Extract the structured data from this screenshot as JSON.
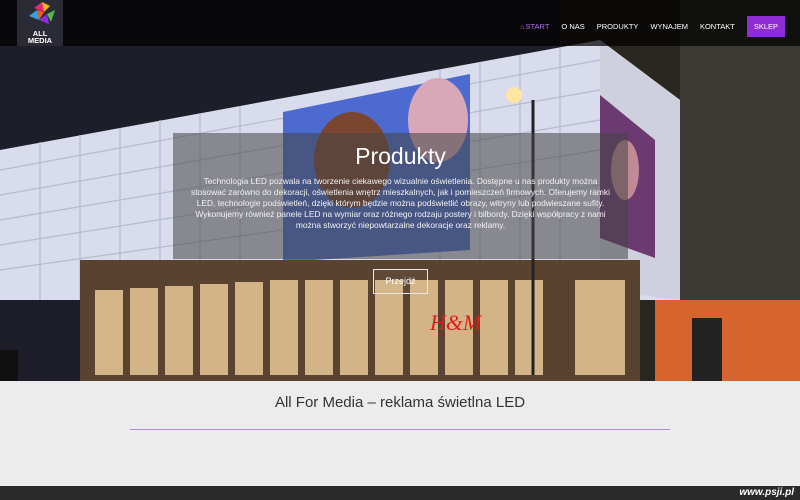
{
  "brand": {
    "logo_line1": "ALL",
    "logo_line2": "MEDIA"
  },
  "nav": {
    "items": [
      {
        "label": "START",
        "active": true
      },
      {
        "label": "O NAS"
      },
      {
        "label": "PRODUKTY"
      },
      {
        "label": "WYNAJEM"
      },
      {
        "label": "KONTAKT"
      }
    ],
    "shop_label": "SKLEP"
  },
  "hero": {
    "title": "Produkty",
    "text": "Technologia LED pozwala na tworzenie ciekawego wizualnie oświetlenia. Dostępne u nas produkty można stosować zarówno do dekoracji, oświetlenia wnętrz mieszkalnych, jak i pomieszczeń firmowych. Oferujemy ramki LED, technologie podświetleń, dzięki którym będzie można podświetlić obrazy, witryny lub podwieszane sufity. Wykonujemy również panele LED na wymiar oraz różnego rodzaju postery i bilbordy. Dzięki współpracy z nami można stworzyć niepowtarzalne dekoracje oraz reklamy.",
    "button_label": "Przejdź",
    "store_sign": "H&M",
    "watermark_word1": "ALL",
    "watermark_word2": "MEDIA"
  },
  "main": {
    "tagline": "All For Media – reklama świetlna LED"
  },
  "footer": {
    "watermark": "www.psji.pl"
  },
  "colors": {
    "accent": "#8e2cd6",
    "nav_active": "#b06cf0",
    "rule": "#b58ad8"
  }
}
